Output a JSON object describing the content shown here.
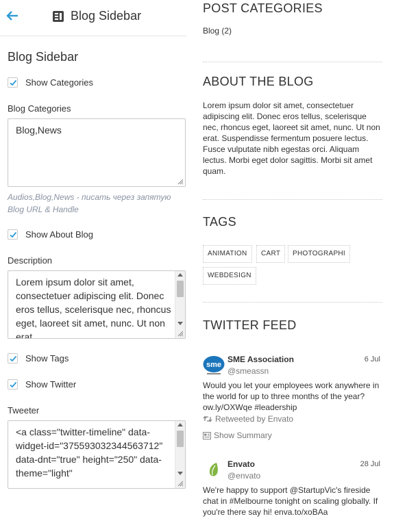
{
  "header": {
    "title": "Blog Sidebar"
  },
  "settings": {
    "section_title": "Blog Sidebar",
    "show_categories": {
      "label": "Show Categories",
      "checked": true
    },
    "blog_categories": {
      "label": "Blog Categories",
      "value": "Blog,News",
      "hint": "Audios,Blog,News - писать через запятую Blog URL & Handle"
    },
    "show_about": {
      "label": "Show About Blog",
      "checked": true
    },
    "description": {
      "label": "Description",
      "value": "Lorem ipsum dolor sit amet, consectetuer adipiscing elit. Donec eros tellus, scelerisque nec, rhoncus eget, laoreet sit amet, nunc. Ut non erat"
    },
    "show_tags": {
      "label": "Show Tags",
      "checked": true
    },
    "show_twitter": {
      "label": "Show Twitter",
      "checked": true
    },
    "tweeter": {
      "label": "Tweeter",
      "value": "<a class=\"twitter-timeline\" data-widget-id=\"375593032344563712\" data-dnt=\"true\" height=\"250\" data-theme=\"light\""
    }
  },
  "preview": {
    "categories": {
      "title": "POST CATEGORIES",
      "items": [
        {
          "label": "Blog (2)"
        }
      ]
    },
    "about": {
      "title": "ABOUT THE BLOG",
      "text": "Lorem ipsum dolor sit amet, consectetuer adipiscing elit. Donec eros tellus, scelerisque nec, rhoncus eget, laoreet sit amet, nunc. Ut non erat. Suspendisse fermentum posuere lectus. Fusce vulputate nibh egestas orci. Aliquam lectus. Morbi eget dolor sagittis. Morbi sit amet quam."
    },
    "tags": {
      "title": "TAGS",
      "items": [
        "ANIMATION",
        "CART",
        "PHOTOGRAPHI",
        "WEBDESIGN"
      ]
    },
    "twitter": {
      "title": "TWITTER FEED",
      "tweets": [
        {
          "name": "SME Association",
          "handle": "@smeassn",
          "date": "6 Jul",
          "avatar_text": "sme",
          "text": "Would you let your employees work anywhere in the world for up to three months of the year? ow.ly/OXWqe #leadership",
          "retweet": "Retweeted by Envato",
          "summary": "Show Summary"
        },
        {
          "name": "Envato",
          "handle": "@envato",
          "date": "28 Jul",
          "text": "We're happy to support @StartupVic's fireside chat in #Melbourne tonight on scaling globally. If you're there say hi! enva.to/xoBAa"
        }
      ]
    }
  },
  "colors": {
    "accent": "#2f9bd6",
    "envato_green": "#82b541",
    "sme_blue": "#1b75bb"
  }
}
